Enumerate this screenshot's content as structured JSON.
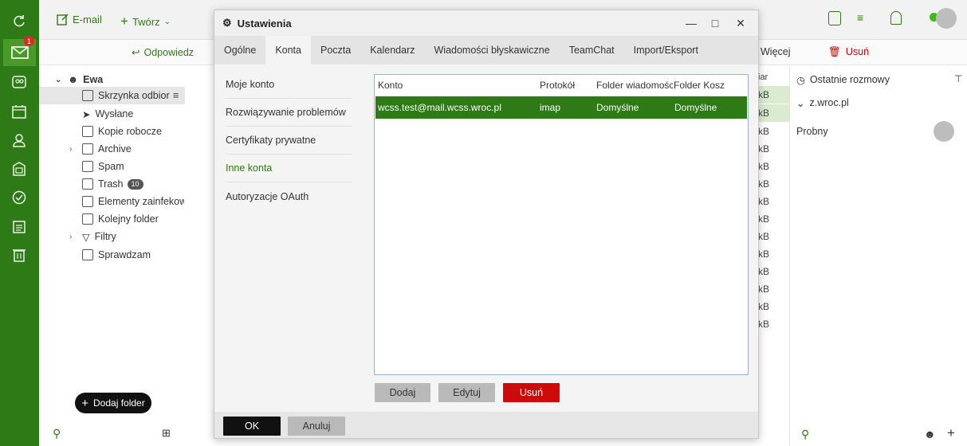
{
  "rail": {
    "badge": "1"
  },
  "toolbar": {
    "email": "E-mail",
    "create": "Twórz",
    "reply": "Odpowiedz",
    "more": "Więcej",
    "delete": "Usuń"
  },
  "folders": {
    "account": "Ewa",
    "inbox": "Skrzynka odbiorcza",
    "sent": "Wysłane",
    "drafts": "Kopie robocze",
    "archive": "Archive",
    "spam": "Spam",
    "trash": "Trash",
    "trash_count": "10",
    "infected": "Elementy zainfekowane",
    "next": "Kolejny folder",
    "filters": "Filtry",
    "checking": "Sprawdzam",
    "add_folder": "Dodaj folder"
  },
  "maillist": {
    "col_size": "iar",
    "sizes": [
      "kB",
      "kB",
      "kB",
      "kB",
      "kB",
      "kB",
      "kB",
      "kB",
      "kB",
      "kB",
      "kB",
      "kB",
      "kB",
      "kB"
    ]
  },
  "rightpanel": {
    "recent": "Ostatnie rozmowy",
    "group": "z.wroc.pl",
    "contact": "Probny"
  },
  "dialog": {
    "title": "Ustawienia",
    "tabs": [
      "Ogólne",
      "Konta",
      "Poczta",
      "Kalendarz",
      "Wiadomości błyskawiczne",
      "TeamChat",
      "Import/Eksport"
    ],
    "side": [
      "Moje konto",
      "Rozwiązywanie problemów",
      "Certyfikaty prywatne",
      "Inne konta",
      "Autoryzacje OAuth"
    ],
    "table": {
      "headers": [
        "Konto",
        "Protokół",
        "Folder wiadomości wysłanych",
        "Folder Kosz"
      ],
      "rows": [
        {
          "account": "wcss.test@mail.wcss.wroc.pl",
          "protocol": "imap",
          "sent": "Domyślne",
          "trash": "Domyślne"
        }
      ]
    },
    "buttons": {
      "add": "Dodaj",
      "edit": "Edytuj",
      "remove": "Usuń",
      "ok": "OK",
      "cancel": "Anuluj"
    }
  }
}
